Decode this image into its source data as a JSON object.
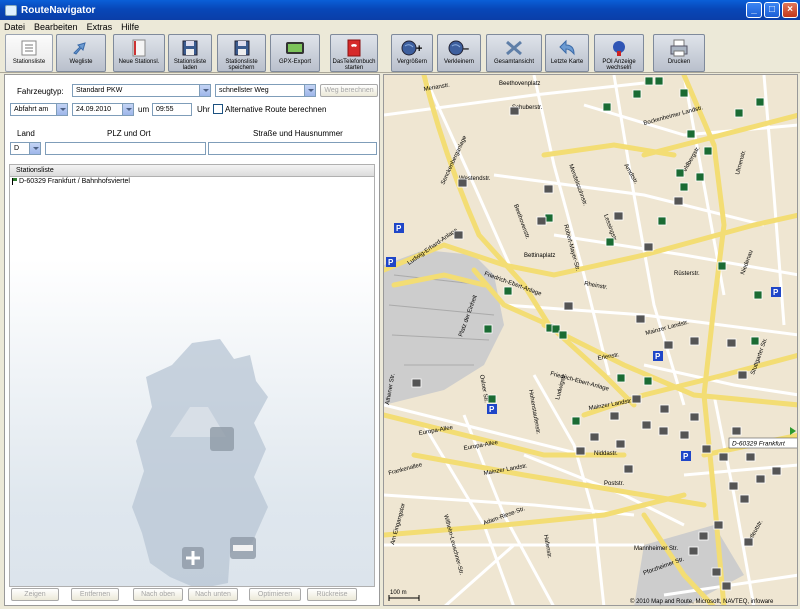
{
  "window": {
    "title": "RouteNavigator"
  },
  "menu": [
    "Datei",
    "Bearbeiten",
    "Extras",
    "Hilfe"
  ],
  "toolbar": [
    {
      "label": "Stationsliste",
      "icon": "list-icon"
    },
    {
      "label": "Wegliste",
      "icon": "route-arrows-icon"
    },
    {
      "label": "Neue Stationsl.",
      "icon": "new-list-icon"
    },
    {
      "label": "Stationsliste laden",
      "icon": "load-disk-icon"
    },
    {
      "label": "Stationsliste speichern",
      "icon": "save-disk-icon"
    },
    {
      "label": "GPX-Export",
      "icon": "gps-device-icon"
    },
    {
      "label": "DasTelefonbuch starten",
      "icon": "phonebook-icon"
    },
    {
      "label": "Vergrößern",
      "icon": "zoom-in-globe-icon"
    },
    {
      "label": "Verkleinern",
      "icon": "zoom-out-globe-icon"
    },
    {
      "label": "Gesamtansicht",
      "icon": "overview-icon"
    },
    {
      "label": "Letzte Karte",
      "icon": "back-arrow-icon"
    },
    {
      "label": "POI Anzeige wechseln",
      "icon": "poi-icon"
    },
    {
      "label": "Drucken",
      "icon": "printer-icon"
    }
  ],
  "form": {
    "vehicle_label": "Fahrzeugtyp:",
    "vehicle_value": "Standard PKW",
    "route_type": "schnellster Weg",
    "calc_button": "Weg berechnen",
    "departure_mode": "Abfahrt am",
    "date": "24.09.2010",
    "um": "um",
    "time": "09:55",
    "uhr": "Uhr",
    "alt_route_label": "Alternative Route berechnen",
    "land_label": "Land",
    "plz_label": "PLZ und Ort",
    "street_label": "Straße und Hausnummer",
    "land_value": "D",
    "plz_value": "",
    "street_value": ""
  },
  "stationsliste": {
    "header": "Stationsliste",
    "items": [
      "D-60329 Frankfurt / Bahnhofsviertel"
    ]
  },
  "bottom_buttons": [
    "Zeigen",
    "Entfernen",
    "Nach oben",
    "Nach unten",
    "Optimieren",
    "Rückreise"
  ],
  "map": {
    "streets": [
      "Merianstr.",
      "Beethovenplatz",
      "Schuberstr.",
      "Bockenheimer Landstr.",
      "Wolfsgangstr.",
      "Liebigstr.",
      "Grüneburgweg",
      "Senckenberganlage",
      "Westendstr.",
      "Mendelssohnstr.",
      "Arndtstr.",
      "Lindenstr.",
      "Feldbergstr.",
      "Ulmenstr.",
      "Niedenau",
      "Beethovenstr.",
      "Robert-Mayer-Str.",
      "Zeppelinallee",
      "Ludwig-Erhard-Anlage",
      "Friedrich-Ebert-Anlage",
      "Bettinaplatz",
      "Bettinastr.",
      "Rheinstr.",
      "Lessingstr.",
      "Wiesenau",
      "Kettenhofweg",
      "Rüsterstr.",
      "Mainzer Landstr.",
      "Erlenstr.",
      "Platz der Einheit",
      "Osloer Str.",
      "Emser Brücke",
      "Gutleutstr.",
      "Ludwigstr.",
      "Europa-Allee",
      "Niddastr.",
      "Hohenstaufenstr.",
      "Weserstr.",
      "Poststr.",
      "Frankenallee",
      "Adam-Riese-Str.",
      "Am Eingangstor",
      "Hafenstr.",
      "Mannheimer Str.",
      "Pforzheimer Str.",
      "Güterplatz",
      "Wilhelm-Leuschner-Str.",
      "Athener Str.",
      "Stuttgarter Str."
    ],
    "location_label": "D-60329 Frankfurt",
    "scale": "100 m",
    "copyright": "© 2010 Map and Route, Microsoft, NAVTEQ, infoware"
  },
  "colors": {
    "titlebar": "#0a48c0",
    "map_background": "#efe6d2",
    "major_road": "#f3dd74",
    "rail_area": "#cfcfcf",
    "poi_restaurant": "#1a6b33",
    "poi_parking": "#1f46c8"
  }
}
